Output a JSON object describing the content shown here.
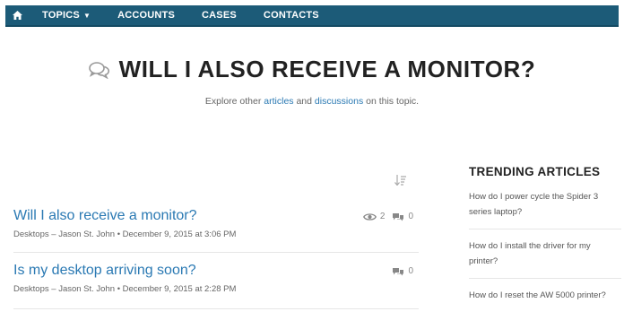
{
  "nav": {
    "home_icon": "home-icon",
    "items": [
      {
        "label": "TOPICS",
        "has_caret": true
      },
      {
        "label": "ACCOUNTS"
      },
      {
        "label": "CASES"
      },
      {
        "label": "CONTACTS"
      }
    ],
    "color": "#1c5b78"
  },
  "header": {
    "icon": "discussion-bubbles-icon",
    "title": "WILL I ALSO RECEIVE A MONITOR?",
    "subtitle_prefix": "Explore other",
    "link_articles": "articles",
    "subtitle_and": "and",
    "link_discussions": "discussions",
    "subtitle_suffix": "on this topic."
  },
  "discussions": [
    {
      "title": "Will I also receive a monitor?",
      "topic": "Desktops",
      "author": "Jason St. John",
      "date": "December 9, 2015 at 3:06 PM",
      "views": "2",
      "replies": "0"
    },
    {
      "title": "Is my desktop arriving soon?",
      "topic": "Desktops",
      "author": "Jason St. John",
      "date": "December 9, 2015 at 2:28 PM",
      "replies": "0"
    }
  ],
  "trending": {
    "title": "TRENDING ARTICLES",
    "items": [
      "How do I power cycle the Spider 3 series laptop?",
      "How do I install the driver for my printer?",
      "How do I reset the AW 5000 printer?"
    ]
  },
  "colors": {
    "link": "#2a79b3",
    "nav_bg": "#1c5b78"
  }
}
